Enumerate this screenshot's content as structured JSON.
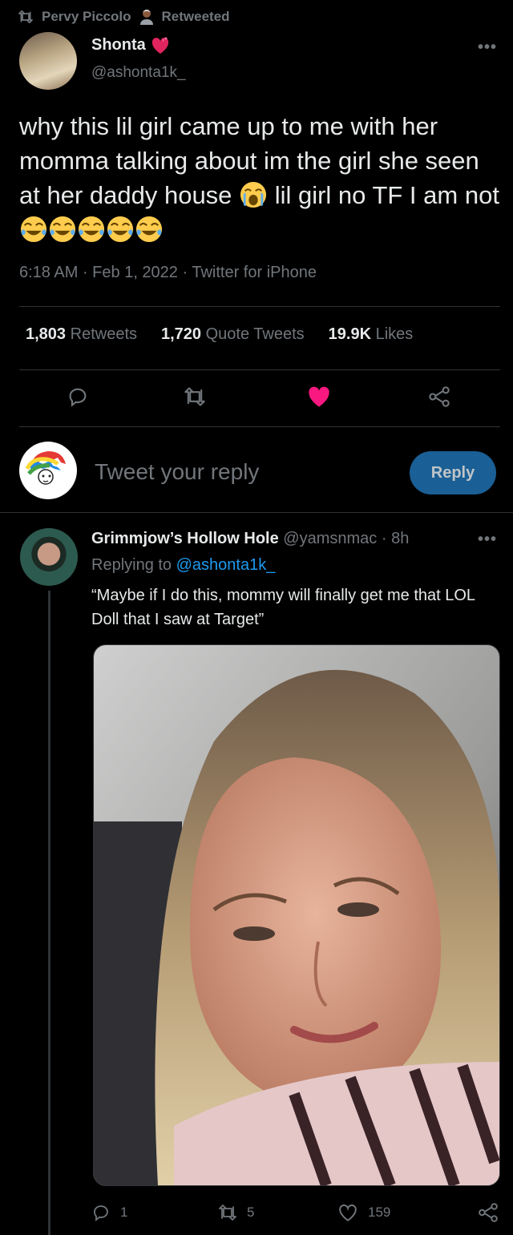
{
  "retweet": {
    "by": "Pervy Piccolo",
    "label": "Retweeted"
  },
  "tweet": {
    "author_name": "Shonta",
    "author_handle": "@ashonta1k_",
    "text_line1": "why this lil girl came up to me with her momma talking about im the girl she seen at her daddy house",
    "text_line2": "lil girl no TF I am not",
    "time": "6:18 AM",
    "date": "Feb 1, 2022",
    "client": "Twitter for iPhone",
    "retweets_count": "1,803",
    "retweets_label": "Retweets",
    "quotes_count": "1,720",
    "quotes_label": "Quote Tweets",
    "likes_count": "19.9K",
    "likes_label": "Likes"
  },
  "composer": {
    "placeholder": "Tweet your reply",
    "button": "Reply"
  },
  "reply": {
    "author_name": "Grimmjow’s Hollow Hole",
    "author_handle": "@yamsnmac",
    "time": "8h",
    "replying_prefix": "Replying to",
    "replying_to": "@ashonta1k_",
    "text": "“Maybe if I do this,  mommy will finally get me that LOL Doll that I saw at Target”",
    "reply_count": "1",
    "retweet_count": "5",
    "like_count": "159"
  },
  "colors": {
    "accent": "#1d9bf0",
    "like": "#f91880",
    "muted": "#71767b",
    "text": "#e7e9ea",
    "background": "#000000",
    "divider": "#2f3336"
  },
  "icons": [
    "retweet-icon",
    "person-icon",
    "heart-icon",
    "more-icon",
    "loudly-crying-face-icon",
    "tears-of-joy-face-icon",
    "reply-icon",
    "like-icon",
    "share-icon"
  ]
}
